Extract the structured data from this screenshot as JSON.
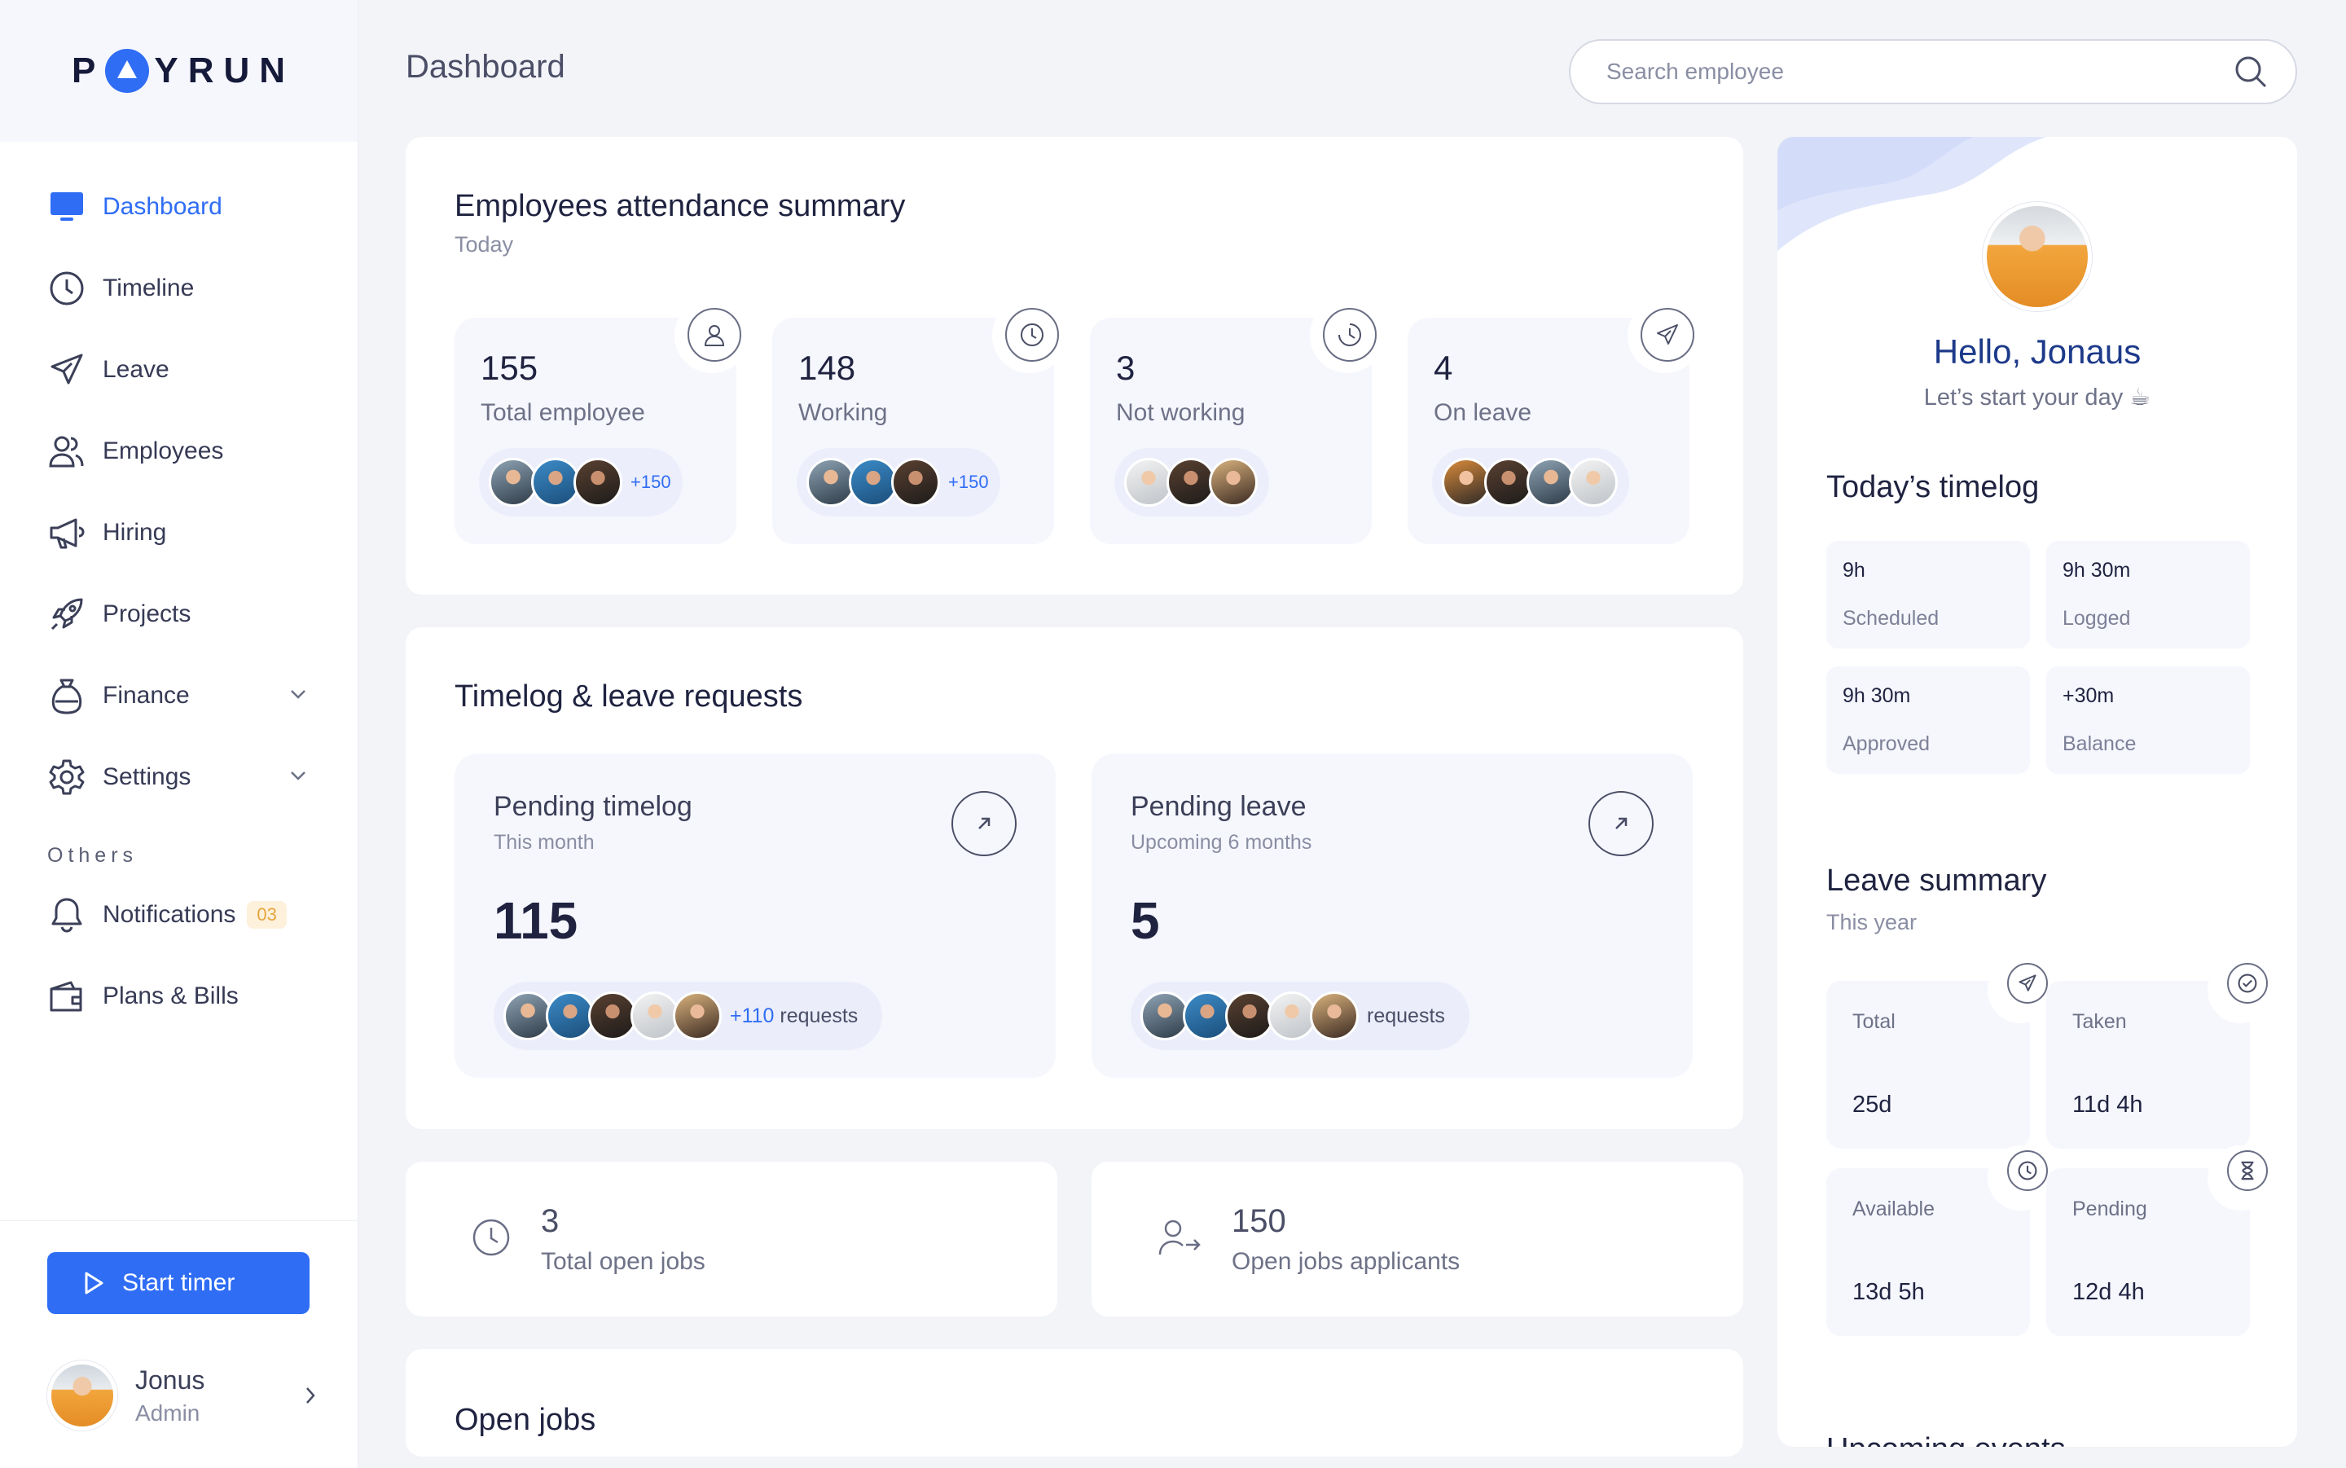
{
  "app": {
    "brand": "PAYRUN",
    "page_title": "Dashboard"
  },
  "search": {
    "placeholder": "Search employee"
  },
  "sidebar": {
    "items": [
      {
        "label": "Dashboard",
        "icon": "monitor-icon"
      },
      {
        "label": "Timeline",
        "icon": "clock-icon"
      },
      {
        "label": "Leave",
        "icon": "plane-icon"
      },
      {
        "label": "Employees",
        "icon": "users-icon"
      },
      {
        "label": "Hiring",
        "icon": "megaphone-icon"
      },
      {
        "label": "Projects",
        "icon": "rocket-icon"
      },
      {
        "label": "Finance",
        "icon": "money-bag-icon"
      },
      {
        "label": "Settings",
        "icon": "gear-icon"
      }
    ],
    "others_label": "Others",
    "others": [
      {
        "label": "Notifications",
        "icon": "bell-icon",
        "badge": "03"
      },
      {
        "label": "Plans & Bills",
        "icon": "wallet-icon"
      }
    ],
    "start_timer": "Start timer",
    "user": {
      "name": "Jonus",
      "role": "Admin"
    }
  },
  "attendance": {
    "title": "Employees attendance summary",
    "subtitle": "Today",
    "stats": [
      {
        "value": "155",
        "label": "Total employee",
        "more": "+150",
        "icon": "user-icon"
      },
      {
        "value": "148",
        "label": "Working",
        "more": "+150",
        "icon": "clock-icon"
      },
      {
        "value": "3",
        "label": "Not working",
        "more": "",
        "icon": "timer-icon"
      },
      {
        "value": "4",
        "label": "On leave",
        "more": "",
        "icon": "plane-icon"
      }
    ]
  },
  "requests": {
    "title": "Timelog & leave requests",
    "pending_timelog": {
      "title": "Pending timelog",
      "subtitle": "This month",
      "value": "115",
      "more": "+110",
      "suffix": "requests"
    },
    "pending_leave": {
      "title": "Pending leave",
      "subtitle": "Upcoming 6 months",
      "value": "5",
      "suffix": "requests"
    }
  },
  "jobs": {
    "open_jobs": {
      "value": "3",
      "label": "Total open jobs"
    },
    "applicants": {
      "value": "150",
      "label": "Open jobs applicants"
    },
    "section_title": "Open jobs"
  },
  "profile": {
    "greeting": "Hello, Jonaus",
    "tagline": "Let’s start your day",
    "tagline_icon": "coffee-icon"
  },
  "timelog": {
    "title": "Today’s timelog",
    "items": [
      {
        "value": "9h",
        "label": "Scheduled"
      },
      {
        "value": "9h 30m",
        "label": "Logged"
      },
      {
        "value": "9h 30m",
        "label": "Approved"
      },
      {
        "value": "+30m",
        "label": "Balance"
      }
    ]
  },
  "leave_summary": {
    "title": "Leave summary",
    "subtitle": "This year",
    "items": [
      {
        "label": "Total",
        "value": "25d",
        "icon": "plane-icon"
      },
      {
        "label": "Taken",
        "value": "11d 4h",
        "icon": "check-circle-icon"
      },
      {
        "label": "Available",
        "value": "13d 5h",
        "icon": "clock-icon"
      },
      {
        "label": "Pending",
        "value": "12d 4h",
        "icon": "hourglass-icon"
      }
    ]
  },
  "upcoming_title": "Upcoming events",
  "colors": {
    "accent": "#2f6df5",
    "greeting": "#1d3a8a",
    "badge_bg": "#fdf1dc",
    "badge_text": "#e6a53c"
  }
}
